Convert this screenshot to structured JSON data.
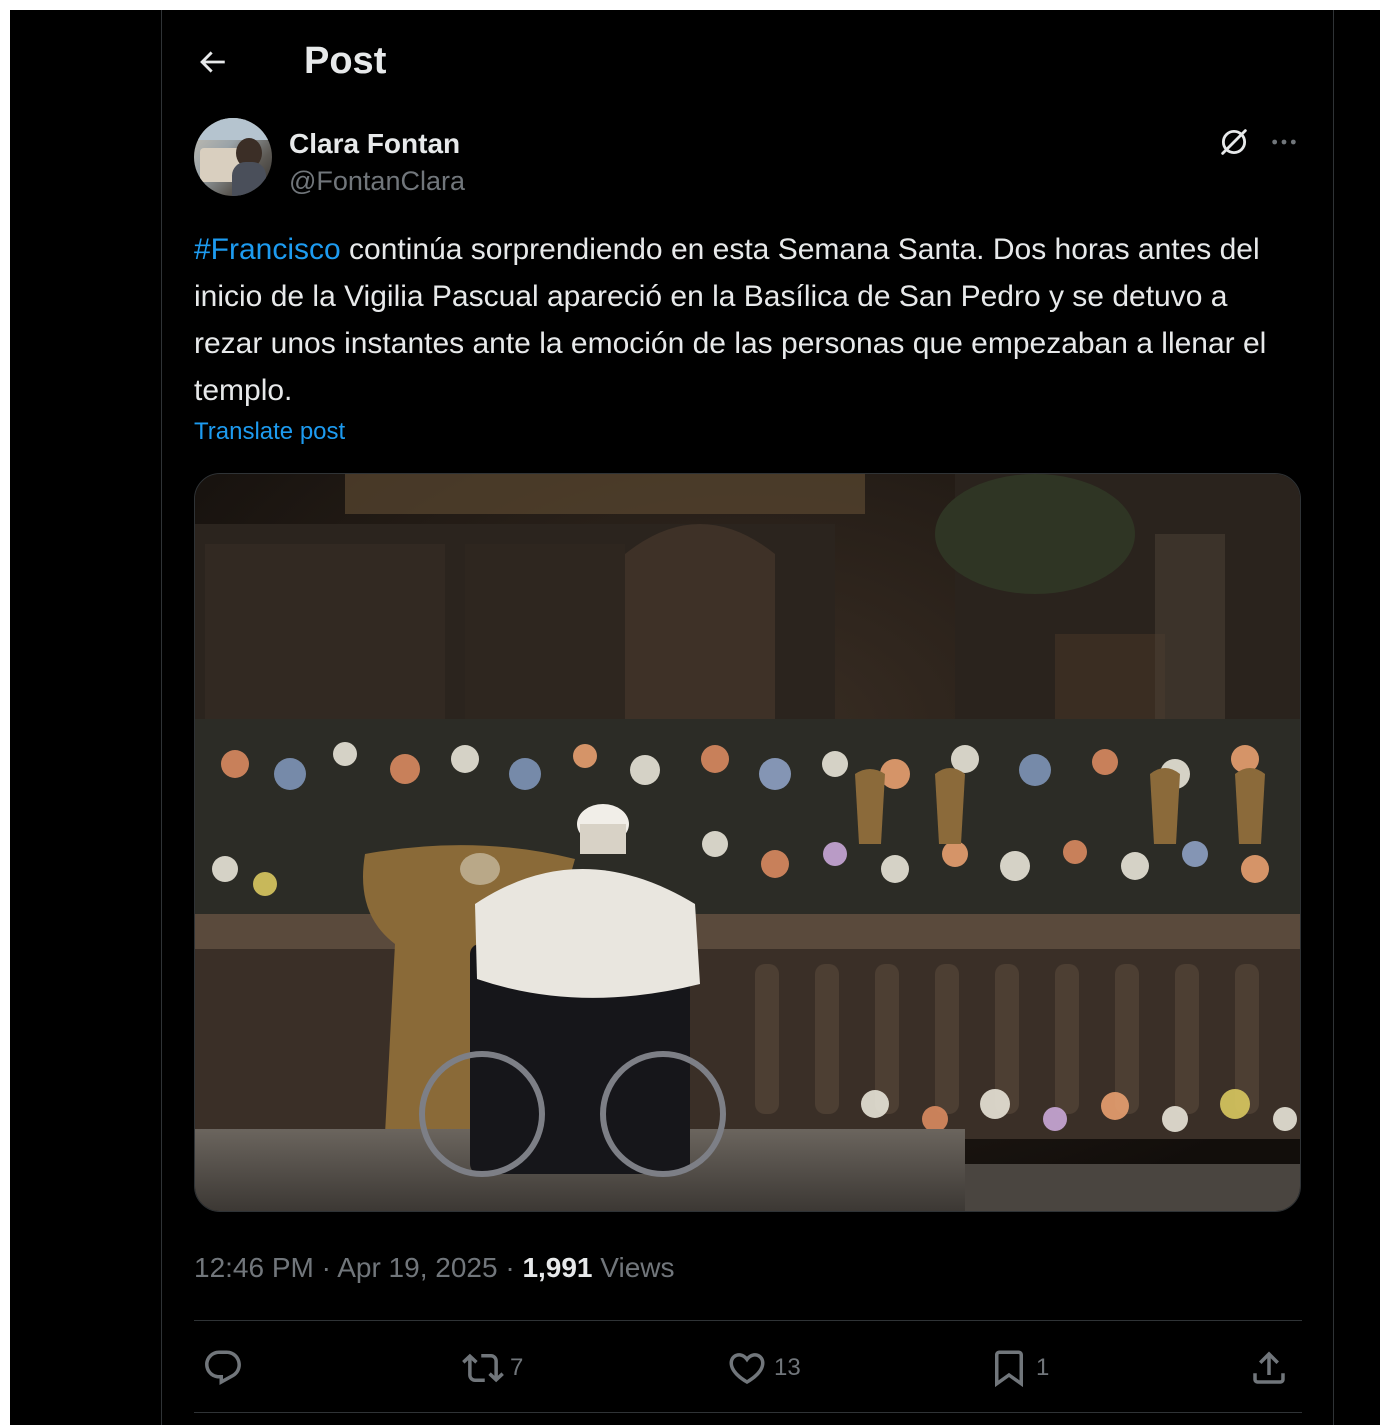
{
  "header": {
    "back_icon": "arrow-left-icon",
    "title": "Post"
  },
  "author": {
    "name": "Clara Fontan",
    "handle": "@FontanClara",
    "grok_icon": "grok-icon",
    "more_icon": "more-horizontal-icon"
  },
  "post": {
    "hashtag": "#Francisco",
    "text": " continúa sorprendiendo en esta Semana Santa. Dos horas antes del inicio de la Vigilia Pascual apareció en la Basílica de San Pedro y se detuvo a rezar unos instantes ante la emoción de las personas que empezaban a llenar el templo.",
    "translate_label": "Translate post"
  },
  "meta": {
    "time": "12:46 PM",
    "separator": " · ",
    "date": "Apr 19, 2025",
    "views_count": "1,991",
    "views_label": "Views"
  },
  "actions": {
    "reply": {
      "icon": "reply-icon",
      "count": ""
    },
    "repost": {
      "icon": "repost-icon",
      "count": "7"
    },
    "like": {
      "icon": "heart-icon",
      "count": "13"
    },
    "bookmark": {
      "icon": "bookmark-icon",
      "count": "1"
    },
    "share": {
      "icon": "share-icon",
      "count": ""
    }
  },
  "colors": {
    "background": "#000000",
    "text": "#e7e9ea",
    "secondary": "#71767b",
    "accent": "#1d9bf0",
    "border": "#2f3336"
  }
}
